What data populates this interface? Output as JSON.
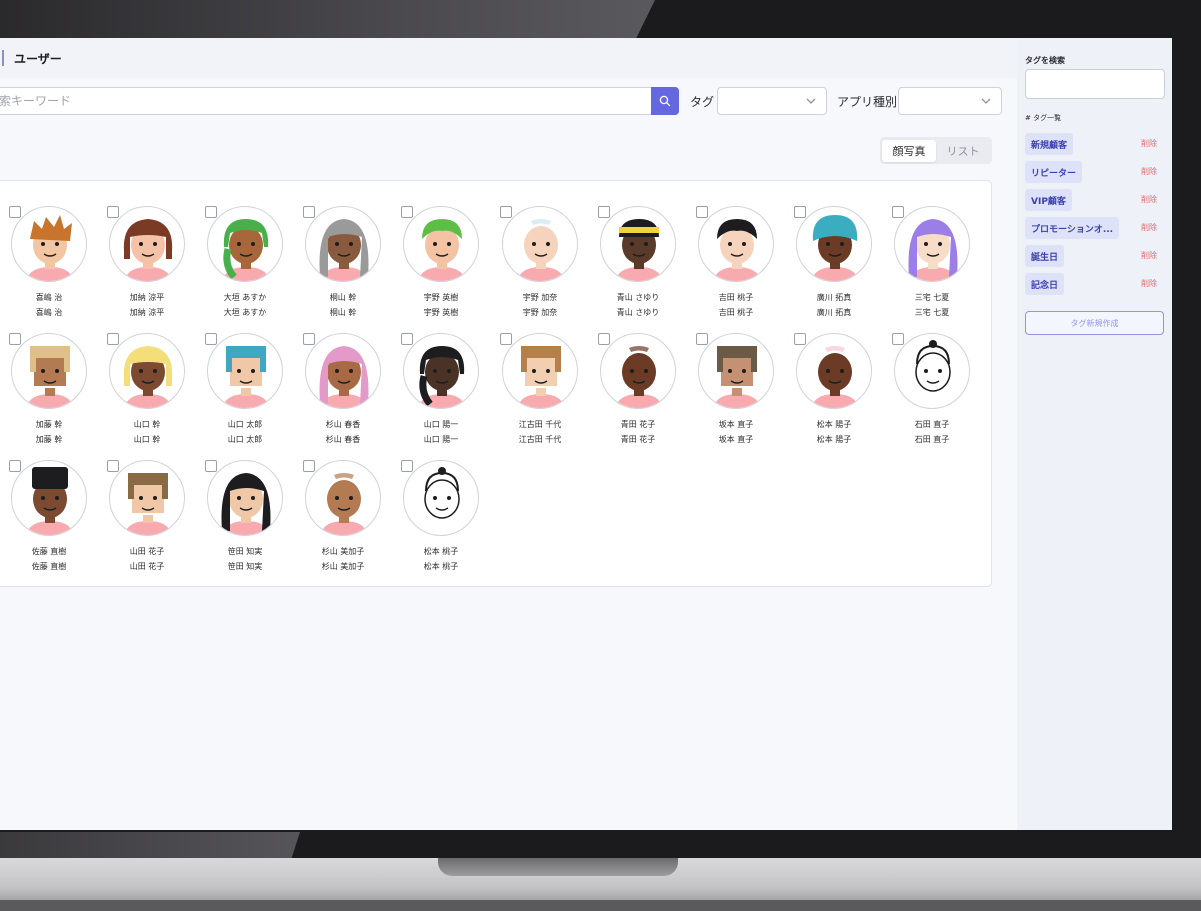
{
  "header": {
    "title": "ユーザー"
  },
  "search": {
    "placeholder": "索キーワード"
  },
  "filters": {
    "tag_label": "タグ",
    "app_type_label": "アプリ種別",
    "tag_value": "",
    "app_type_value": ""
  },
  "view_toggle": {
    "face_label": "顔写真",
    "list_label": "リスト",
    "active": "face"
  },
  "users": [
    {
      "name": "喜嶋 治",
      "skin": "#f2c6a0",
      "hair": "#c8742c",
      "style": "spiky"
    },
    {
      "name": "加納 涼平",
      "skin": "#f5c2a8",
      "hair": "#7b3a23",
      "style": "bob"
    },
    {
      "name": "大垣 あすか",
      "skin": "#a8673b",
      "hair": "#48b04a",
      "style": "braid"
    },
    {
      "name": "桐山 幹",
      "skin": "#8a5a3e",
      "hair": "#9a9a9a",
      "style": "long"
    },
    {
      "name": "宇野 英樹",
      "skin": "#f3c3a3",
      "hair": "#5cbe45",
      "style": "short"
    },
    {
      "name": "宇野 加奈",
      "skin": "#f6d3bd",
      "hair": "#cfe6ef",
      "style": "bald"
    },
    {
      "name": "青山 さゆり",
      "skin": "#5a3a28",
      "hair": "#1d1d1f",
      "style": "band"
    },
    {
      "name": "吉田 桃子",
      "skin": "#f6d3bd",
      "hair": "#1d1d1f",
      "style": "short"
    },
    {
      "name": "廣川 拓真",
      "skin": "#6b3b26",
      "hair": "#3aaec0",
      "style": "turban"
    },
    {
      "name": "三宅 七夏",
      "skin": "#f7dcc8",
      "hair": "#9b7ee8",
      "style": "long"
    },
    {
      "name": "加藤 幹",
      "skin": "#b47a52",
      "hair": "#e0c08a",
      "style": "pixel"
    },
    {
      "name": "山口 幹",
      "skin": "#7b4a31",
      "hair": "#f3de7a",
      "style": "bob"
    },
    {
      "name": "山口 太郎",
      "skin": "#f0c8a8",
      "hair": "#3fa6c4",
      "style": "pixel"
    },
    {
      "name": "杉山 春香",
      "skin": "#a86a44",
      "hair": "#e49ac8",
      "style": "long"
    },
    {
      "name": "山口 陽一",
      "skin": "#4a3226",
      "hair": "#1d1d1f",
      "style": "braid"
    },
    {
      "name": "江古田 千代",
      "skin": "#f2cfb0",
      "hair": "#b57f4a",
      "style": "pixel"
    },
    {
      "name": "青田 花子",
      "skin": "#6b3b26",
      "hair": "#6b3b26",
      "style": "bald"
    },
    {
      "name": "坂本 直子",
      "skin": "#c69072",
      "hair": "#6b5a45",
      "style": "pixel"
    },
    {
      "name": "松本 陽子",
      "skin": "#6b3b26",
      "hair": "#f2c6d6",
      "style": "bald"
    },
    {
      "name": "石田 直子",
      "skin": "#ffffff",
      "hair": "#1d1d1f",
      "style": "line"
    },
    {
      "name": "佐藤 直樹",
      "skin": "#7b4a31",
      "hair": "#1d1d1f",
      "style": "tall"
    },
    {
      "name": "山田 花子",
      "skin": "#f0c8a8",
      "hair": "#8a6a45",
      "style": "pixel"
    },
    {
      "name": "笹田 知実",
      "skin": "#f0c8a8",
      "hair": "#1d1d1f",
      "style": "long"
    },
    {
      "name": "杉山 美加子",
      "skin": "#b47a52",
      "hair": "#b47a52",
      "style": "bald"
    },
    {
      "name": "松本 桃子",
      "skin": "#ffffff",
      "hair": "#1d1d1f",
      "style": "line"
    }
  ],
  "sidebar": {
    "search_title": "タグを検索",
    "list_title": "# タグ一覧",
    "delete_label": "削除",
    "tags": [
      "新規顧客",
      "リピーター",
      "VIP顧客",
      "プロモーションオ...",
      "誕生日",
      "記念日"
    ],
    "new_tag_label": "タグ新規作成"
  },
  "colors": {
    "accent": "#6467e0",
    "tag_bg": "#dde2f8",
    "delete": "#e46b6b"
  }
}
